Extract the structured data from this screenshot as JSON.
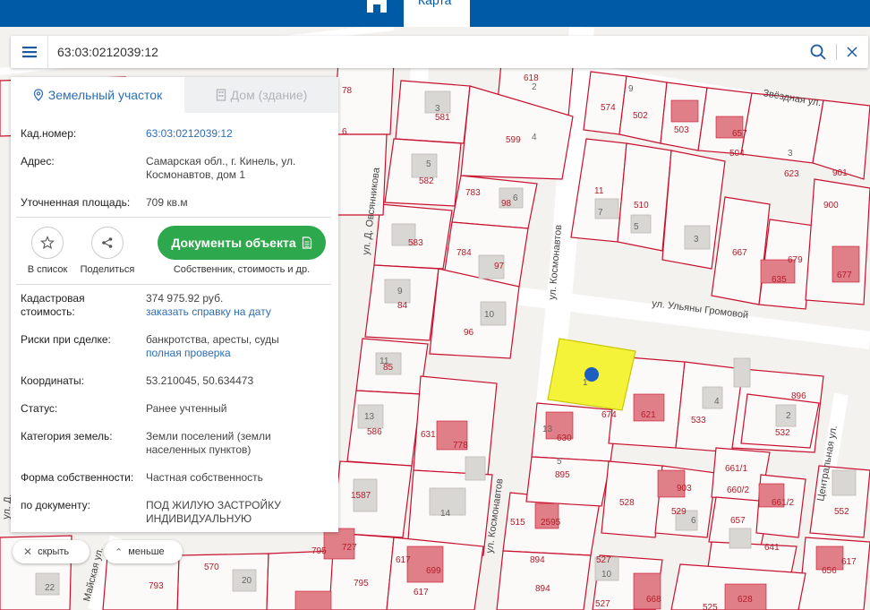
{
  "header": {
    "map_tab": "Карта"
  },
  "search": {
    "value": "63:03:0212039:12"
  },
  "tabs": {
    "land": "Земельный участок",
    "house": "Дом (здание)"
  },
  "info": {
    "cadnum_label": "Кад.номер:",
    "cadnum_value": "63:03:0212039:12",
    "address_label": "Адрес:",
    "address_line1": "Самарская обл., г. Кинель, ул.",
    "address_line2": "Космонавтов, дом 1",
    "area_label": "Уточненная площадь:",
    "area_value": "709 кв.м",
    "cost_label_1": "Кадастровая",
    "cost_label_2": "стоимость:",
    "cost_value": "374 975.92 руб.",
    "cost_link": "заказать справку на дату",
    "risk_label": "Риски при сделке:",
    "risk_value": "банкротства, аресты, суды",
    "risk_link": "полная проверка",
    "coords_label": "Координаты:",
    "coords_value": "53.210045, 50.634473",
    "status_label": "Статус:",
    "status_value": "Ранее учтенный",
    "category_label": "Категория земель:",
    "category_line1": "Земли поселений (земли",
    "category_line2": "населенных пунктов)",
    "ownership_label": "Форма собственности:",
    "ownership_value": "Частная собственность",
    "doc_label": "по документу:",
    "doc_line1": "ПОД ЖИЛУЮ ЗАСТРОЙКУ",
    "doc_line2": "ИНДИВИДУАЛЬНУЮ"
  },
  "actions": {
    "list_label": "В список",
    "share_label": "Поделиться",
    "docs_button": "Документы объекта",
    "docs_sub": "Собственник, стоимость и др."
  },
  "pills": {
    "hide": "скрыть",
    "less": "меньше"
  },
  "map": {
    "streets": [
      "ул. Д. Овсянникова",
      "ул. Космонавтов",
      "ул. Космонавтов",
      "ул. Ульяны Громовой",
      "Звёздная ул.",
      "Центральная ул.",
      "Майская ул.",
      "ул. Д."
    ],
    "labels": [
      "8",
      "618",
      "2",
      "78",
      "6",
      "3",
      "581",
      "599",
      "4",
      "574",
      "9",
      "502",
      "503",
      "657",
      "504",
      "3",
      "623",
      "901",
      "582",
      "5",
      "783",
      "6",
      "98",
      "11",
      "7",
      "510",
      "5",
      "3",
      "667",
      "679",
      "635",
      "678",
      "677",
      "678",
      "900",
      "583",
      "784",
      "97",
      "9",
      "84",
      "10",
      "96",
      "11",
      "85",
      "896",
      "4",
      "533",
      "2",
      "532",
      "13",
      "586",
      "631",
      "778",
      "13",
      "630",
      "674",
      "621",
      "5",
      "895",
      "661/1",
      "660/2",
      "661/2",
      "1",
      "587",
      "14",
      "515",
      "2595",
      "528",
      "903",
      "529",
      "6",
      "657",
      "641",
      "795",
      "727",
      "617",
      "699",
      "617",
      "894",
      "527",
      "10",
      "552",
      "656",
      "617",
      "570",
      "793",
      "22",
      "20",
      "795",
      "894",
      "527",
      "525",
      "668",
      "628",
      "1"
    ],
    "accent": "#c8102e",
    "selected_fill": "#f5f23a"
  }
}
